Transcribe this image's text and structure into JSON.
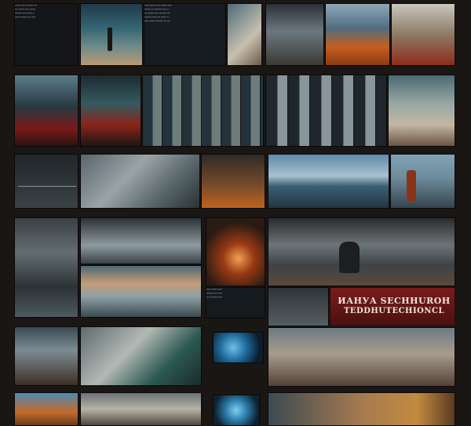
{
  "banner": {
    "line1": "ИАНУА SECHHUROH",
    "line2": "TEDDHUTECHIONCL"
  }
}
